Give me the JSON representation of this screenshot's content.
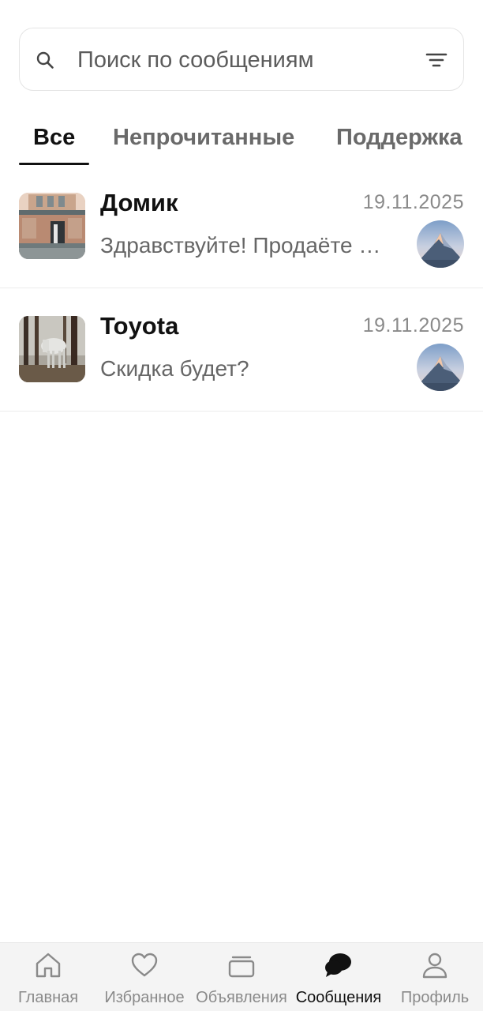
{
  "search": {
    "placeholder": "Поиск по сообщениям"
  },
  "tabs": [
    {
      "label": "Все",
      "active": true
    },
    {
      "label": "Непрочитанные",
      "active": false
    },
    {
      "label": "Поддержка",
      "active": false
    }
  ],
  "chats": [
    {
      "title": "Домик",
      "date": "19.11.2025",
      "preview": "Здравствуйте! Продаёте …",
      "thumbnail": "house-photo",
      "avatar": "mountain-avatar"
    },
    {
      "title": "Toyota",
      "date": "19.11.2025",
      "preview": "Скидка будет?",
      "thumbnail": "horse-photo",
      "avatar": "mountain-avatar"
    }
  ],
  "bottom_nav": [
    {
      "label": "Главная",
      "icon": "home-icon",
      "active": false
    },
    {
      "label": "Избранное",
      "icon": "heart-icon",
      "active": false
    },
    {
      "label": "Объявления",
      "icon": "listings-icon",
      "active": false
    },
    {
      "label": "Сообщения",
      "icon": "chat-icon",
      "active": true
    },
    {
      "label": "Профиль",
      "icon": "profile-icon",
      "active": false
    }
  ],
  "colors": {
    "active_text": "#111111",
    "inactive_text": "#6a6a6a",
    "nav_background": "#f4f4f4"
  }
}
